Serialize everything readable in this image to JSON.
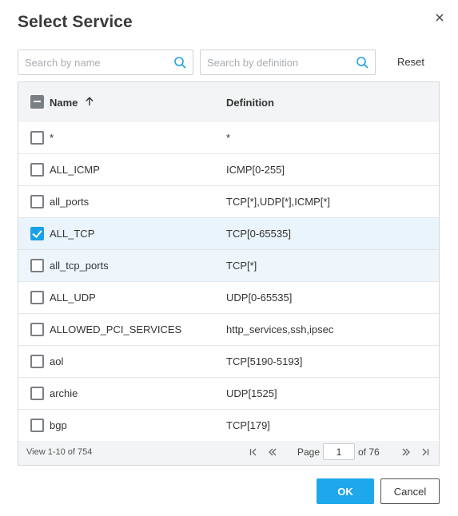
{
  "dialog": {
    "title": "Select Service",
    "close_icon": "close-icon"
  },
  "search": {
    "name_placeholder": "Search by name",
    "name_value": "",
    "definition_placeholder": "Search by definition",
    "definition_value": "",
    "search_icon": "search-icon",
    "reset_label": "Reset"
  },
  "table": {
    "header_name": "Name",
    "header_definition": "Definition",
    "sort_icon": "arrow-up-icon",
    "header_checkbox_state": "indeterminate",
    "rows": [
      {
        "name": "*",
        "definition": "*",
        "checked": false
      },
      {
        "name": "ALL_ICMP",
        "definition": "ICMP[0-255]",
        "checked": false
      },
      {
        "name": "all_ports",
        "definition": "TCP[*],UDP[*],ICMP[*]",
        "checked": false
      },
      {
        "name": "ALL_TCP",
        "definition": "TCP[0-65535]",
        "checked": true
      },
      {
        "name": "all_tcp_ports",
        "definition": "TCP[*]",
        "checked": false
      },
      {
        "name": "ALL_UDP",
        "definition": "UDP[0-65535]",
        "checked": false
      },
      {
        "name": "ALLOWED_PCI_SERVICES",
        "definition": "http_services,ssh,ipsec",
        "checked": false
      },
      {
        "name": "aol",
        "definition": "TCP[5190-5193]",
        "checked": false
      },
      {
        "name": "archie",
        "definition": "UDP[1525]",
        "checked": false
      },
      {
        "name": "bgp",
        "definition": "TCP[179]",
        "checked": false
      }
    ]
  },
  "pagination": {
    "view_text": "View 1-10 of 754",
    "page_label": "Page",
    "current_page": "1",
    "of_label": "of 76",
    "icons": [
      "first-page-icon",
      "previous-page-icon",
      "next-page-icon",
      "last-page-icon"
    ]
  },
  "actions": {
    "ok_label": "OK",
    "cancel_label": "Cancel"
  },
  "colors": {
    "accent": "#1ea7ea",
    "selected_row": "#eaf4fc",
    "header_bg": "#f3f4f5"
  }
}
